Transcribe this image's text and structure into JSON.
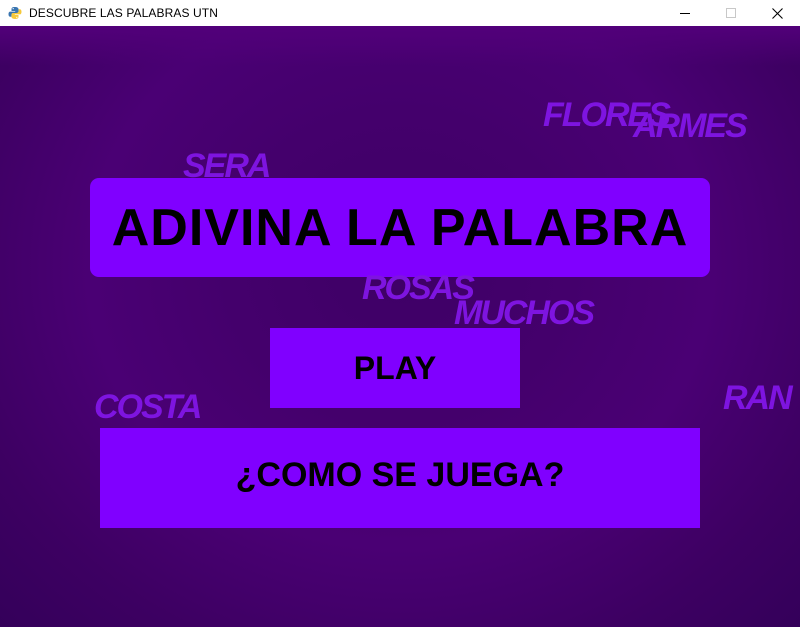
{
  "window": {
    "title": "DESCUBRE LAS PALABRAS UTN",
    "icon": "python-icon",
    "controls": [
      "minimize",
      "maximize",
      "close"
    ]
  },
  "game": {
    "background_color": "#4a0074",
    "accent_color": "#8000ff",
    "word_color": "#7e14e0",
    "floating_words": {
      "flores": "FLORES",
      "armes": "ARMES",
      "sera": "SERA",
      "rosas": "ROSAS",
      "muchos": "MUCHOS",
      "costa": "COSTA",
      "ran": "RAN"
    },
    "title": "ADIVINA LA PALABRA",
    "play_label": "PLAY",
    "how_to_play_label": "¿COMO SE JUEGA?"
  }
}
